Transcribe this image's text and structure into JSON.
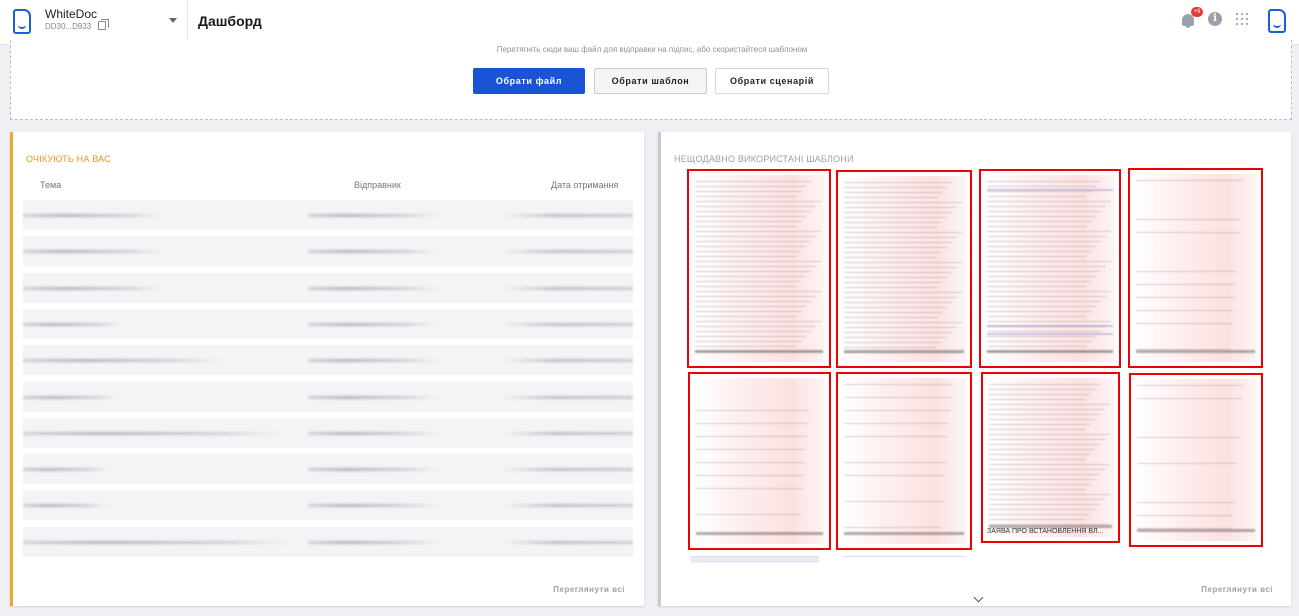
{
  "header": {
    "org_name": "WhiteDoc",
    "org_id": "DD30...D933",
    "page_title": "Дашборд",
    "notifications_count": "+9"
  },
  "upload": {
    "hint": "Перетягніть сюди ваш файл для відправки на підпис, або скористайтеся шаблоном",
    "choose_file": "Обрати файл",
    "choose_template": "Обрати шаблон",
    "choose_scenario": "Обрати сценарій"
  },
  "waiting": {
    "title": "ОЧІКУЮТЬ НА ВАС",
    "columns": [
      "Тема",
      "Відправник",
      "Дата отримання"
    ],
    "view_all": "Переглянути всі"
  },
  "templates": {
    "title": "НЕЩОДАВНО ВИКОРИСТАНІ ШАБЛОНИ",
    "view_all": "Переглянути всі",
    "thumb_caption": "ЗАЯВА ПРО ВСТАНОВЛЕННЯ ВЛ..."
  },
  "colors": {
    "accent": "#1b53d6",
    "waiting_accent": "#f0a531",
    "highlight_box": "#e00000"
  }
}
